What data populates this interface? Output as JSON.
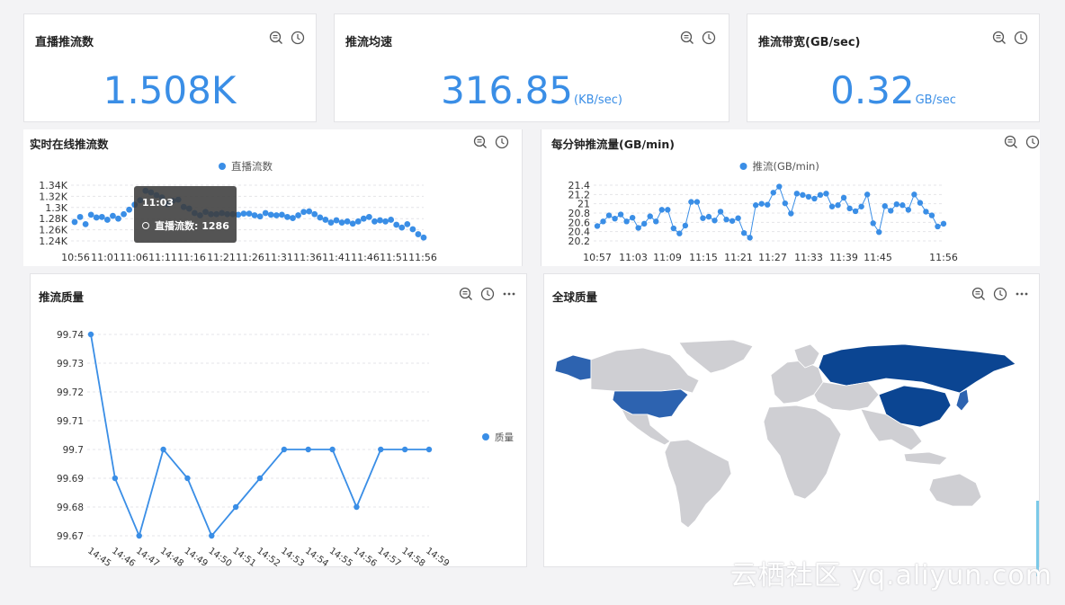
{
  "kpis": [
    {
      "title": "直播推流数",
      "value": "1.508K",
      "unit": ""
    },
    {
      "title": "推流均速",
      "value": "316.85",
      "unit": "(KB/sec)"
    },
    {
      "title": "推流带宽(GB/sec)",
      "value": "0.32",
      "unit": "GB/sec"
    }
  ],
  "panels": {
    "realtime": {
      "title": "实时在线推流数",
      "tooltip": {
        "time": "11:03",
        "label": "直播流数: 1286"
      }
    },
    "per_minute": {
      "title": "每分钟推流量(GB/min)"
    },
    "quality": {
      "title": "推流质量"
    },
    "global": {
      "title": "全球质量"
    }
  },
  "colors": {
    "accent": "#3a8ee6",
    "map_dark": "#0b4592",
    "map_mid": "#2d63b0",
    "map_land": "#cfcfd3"
  },
  "icons": [
    "search-list-icon",
    "clock-icon",
    "more-icon"
  ],
  "watermark": "云栖社区 yq.aliyun.com",
  "chart_data": [
    {
      "id": "realtime",
      "type": "scatter",
      "series": [
        {
          "name": "直播流数",
          "values": [
            1274,
            1283,
            1270,
            1287,
            1282,
            1283,
            1278,
            1285,
            1280,
            1288,
            1296,
            1305,
            1313,
            1330,
            1327,
            1322,
            1318,
            1306,
            1312,
            1314,
            1301,
            1298,
            1290,
            1286,
            1292,
            1288,
            1288,
            1290,
            1288,
            1288,
            1287,
            1289,
            1289,
            1286,
            1284,
            1290,
            1287,
            1286,
            1287,
            1283,
            1281,
            1286,
            1292,
            1293,
            1288,
            1282,
            1278,
            1273,
            1277,
            1273,
            1275,
            1271,
            1275,
            1280,
            1283,
            1275,
            1277,
            1275,
            1278,
            1269,
            1264,
            1270,
            1261,
            1252,
            1246
          ]
        }
      ],
      "x_ticks": [
        "10:56",
        "11:01",
        "11:06",
        "11:11",
        "11:16",
        "11:21",
        "11:26",
        "11:31",
        "11:36",
        "11:41",
        "11:46",
        "11:51",
        "11:56"
      ],
      "y_ticks": [
        "1.24K",
        "1.26K",
        "1.28K",
        "1.3K",
        "1.32K",
        "1.34K"
      ],
      "ylim": [
        1240,
        1340
      ],
      "grid": true,
      "legend": "top-center"
    },
    {
      "id": "per_minute",
      "type": "line",
      "series": [
        {
          "name": "推流(GB/min)",
          "values": [
            20.52,
            20.62,
            20.75,
            20.68,
            20.77,
            20.62,
            20.7,
            20.48,
            20.57,
            20.73,
            20.62,
            20.87,
            20.87,
            20.47,
            20.36,
            20.53,
            21.04,
            21.04,
            20.69,
            20.72,
            20.64,
            20.83,
            20.66,
            20.63,
            20.69,
            20.37,
            20.27,
            20.97,
            21.0,
            20.98,
            21.24,
            21.37,
            21.01,
            20.79,
            21.22,
            21.19,
            21.15,
            21.11,
            21.19,
            21.22,
            20.94,
            20.97,
            21.13,
            20.9,
            20.84,
            20.94,
            21.2,
            20.58,
            20.39,
            20.95,
            20.85,
            20.99,
            20.97,
            20.87,
            21.2,
            21.02,
            20.83,
            20.75,
            20.51,
            20.57
          ]
        }
      ],
      "x_ticks": [
        "10:57",
        "11:03",
        "11:09",
        "11:15",
        "11:21",
        "11:27",
        "11:33",
        "11:39",
        "11:45",
        "11:56"
      ],
      "y_ticks": [
        "20.2",
        "20.4",
        "20.6",
        "20.8",
        "21",
        "21.2",
        "21.4"
      ],
      "ylim": [
        20.2,
        21.4
      ],
      "grid": true,
      "legend": "top-center"
    },
    {
      "id": "quality",
      "type": "line",
      "categories": [
        "14:45",
        "14:46",
        "14:47",
        "14:48",
        "14:49",
        "14:50",
        "14:51",
        "14:52",
        "14:53",
        "14:54",
        "14:55",
        "14:56",
        "14:57",
        "14:58",
        "14:59"
      ],
      "series": [
        {
          "name": "质量",
          "values": [
            99.74,
            99.69,
            99.67,
            99.7,
            99.69,
            99.67,
            99.68,
            99.69,
            99.7,
            99.7,
            99.7,
            99.68,
            99.7,
            99.7,
            99.7
          ]
        }
      ],
      "y_ticks": [
        "99.67",
        "99.68",
        "99.69",
        "99.7",
        "99.71",
        "99.72",
        "99.73",
        "99.74"
      ],
      "ylim": [
        99.67,
        99.74
      ],
      "grid": true,
      "legend": "right"
    }
  ]
}
